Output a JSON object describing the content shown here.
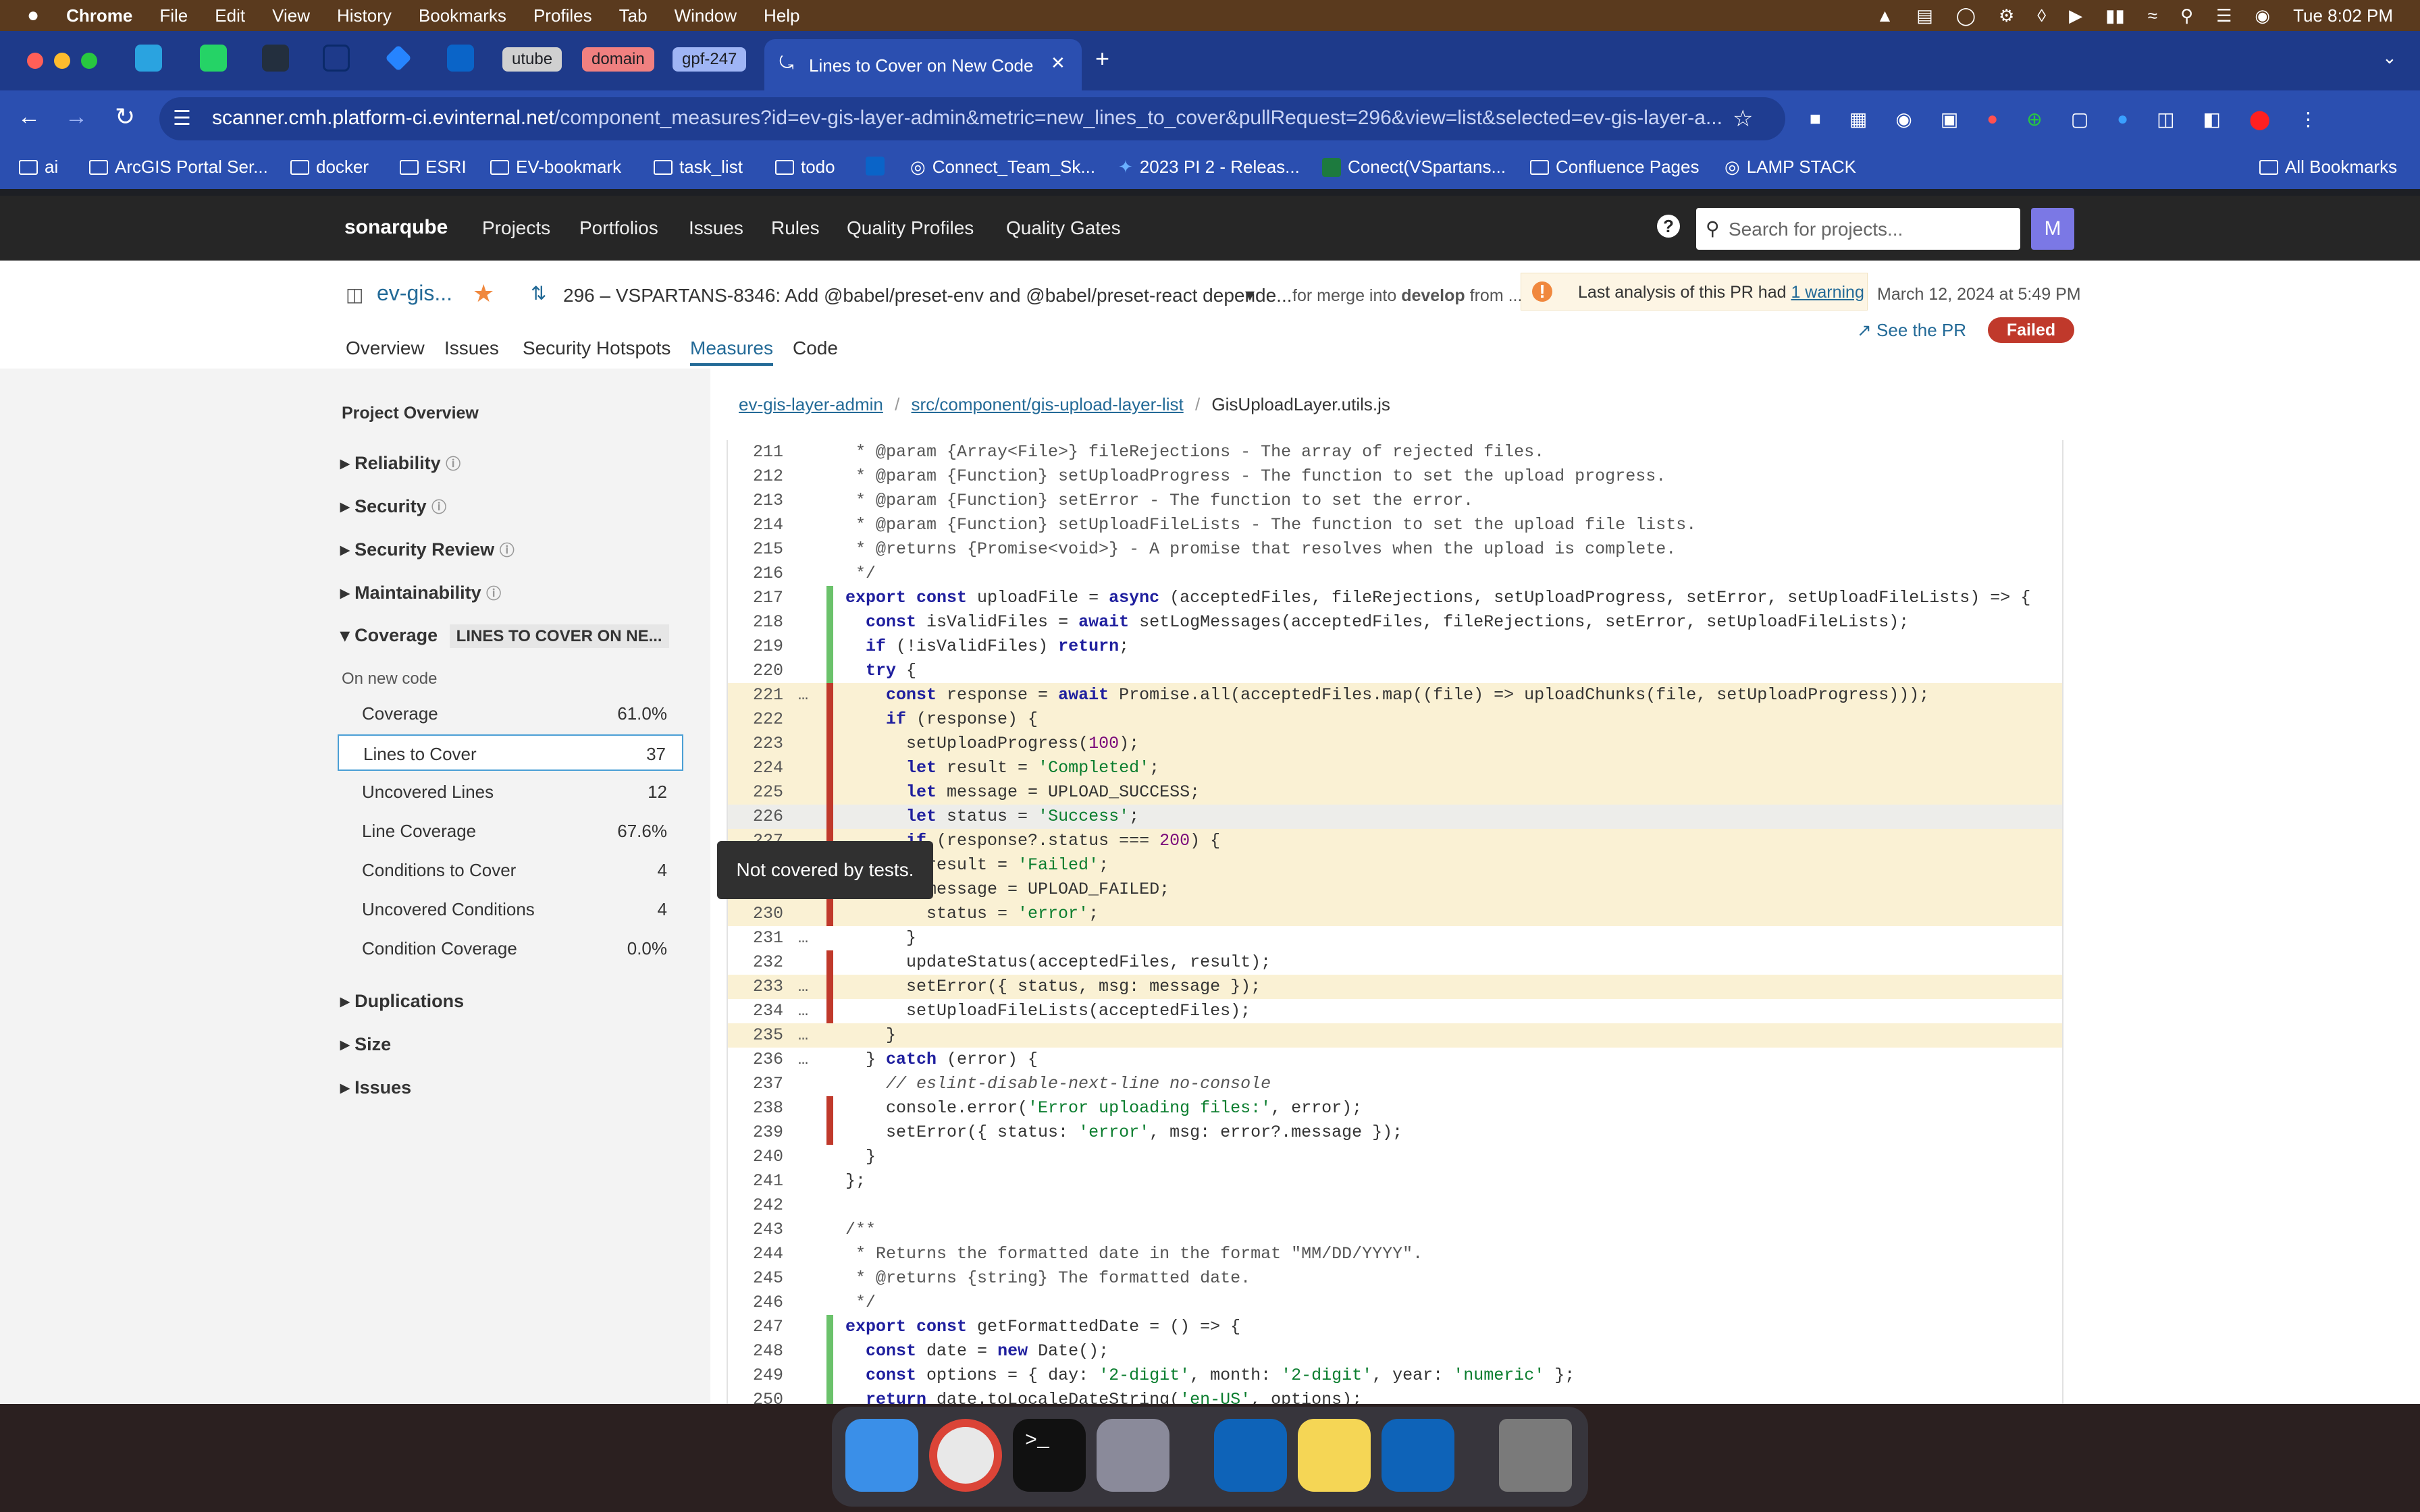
{
  "menubar": {
    "apple": "",
    "items": [
      "Chrome",
      "File",
      "Edit",
      "View",
      "History",
      "Bookmarks",
      "Profiles",
      "Tab",
      "Window",
      "Help"
    ],
    "clock": "Tue 8:02 PM"
  },
  "chrome": {
    "tab_groups": [
      "utube",
      "domain",
      "gpf-247"
    ],
    "active_tab_title": "Lines to Cover on New Code",
    "url_host": "scanner.cmh.platform-ci.evinternal.net",
    "url_path": "/component_measures?id=ev-gis-layer-admin&metric=new_lines_to_cover&pullRequest=296&view=list&selected=ev-gis-layer-a...",
    "bookmarks": [
      "ai",
      "ArcGIS Portal Ser...",
      "docker",
      "ESRI",
      "EV-bookmark",
      "task_list",
      "todo",
      "Connect_Team_Sk...",
      "2023 PI 2 - Releas...",
      "Conect(VSpartans...",
      "Confluence Pages",
      "LAMP STACK"
    ],
    "all_bookmarks": "All Bookmarks"
  },
  "sonar": {
    "logo": "sonarqube",
    "nav": [
      "Projects",
      "Portfolios",
      "Issues",
      "Rules",
      "Quality Profiles",
      "Quality Gates"
    ],
    "search_placeholder": "Search for projects...",
    "avatar": "M",
    "project_name": "ev-gis...",
    "pr_title": "296 – VSPARTANS-8346: Add @babel/preset-env and @babel/preset-react depende...",
    "merge_info_prefix": "for merge into",
    "merge_target": "develop",
    "merge_info_suffix": "from ...",
    "warning_text": "Last analysis of this PR had",
    "warning_link": "1 warning",
    "analysis_date": "March 12, 2024 at 5:49 PM",
    "see_pr": "See the PR",
    "status": "Failed",
    "tabs": [
      "Overview",
      "Issues",
      "Security Hotspots",
      "Measures",
      "Code"
    ],
    "active_tab": "Measures",
    "colors": {
      "failed": "#c0392b",
      "accent": "#236a97",
      "covered": "#6bc26b",
      "uncovered": "#c0392b",
      "uncovered_bg": "#faf1d4"
    }
  },
  "sidebar": {
    "heading": "Project Overview",
    "sections_top": [
      "Reliability",
      "Security",
      "Security Review",
      "Maintainability"
    ],
    "coverage_label": "Coverage",
    "coverage_badge": "LINES TO COVER ON NE...",
    "on_new_code": "On new code",
    "metrics": [
      {
        "label": "Coverage",
        "value": "61.0%"
      },
      {
        "label": "Lines to Cover",
        "value": "37"
      },
      {
        "label": "Uncovered Lines",
        "value": "12"
      },
      {
        "label": "Line Coverage",
        "value": "67.6%"
      },
      {
        "label": "Conditions to Cover",
        "value": "4"
      },
      {
        "label": "Uncovered Conditions",
        "value": "4"
      },
      {
        "label": "Condition Coverage",
        "value": "0.0%"
      }
    ],
    "sections_bottom": [
      "Duplications",
      "Size",
      "Issues"
    ]
  },
  "breadcrumb": {
    "project": "ev-gis-layer-admin",
    "path": "src/component/gis-upload-layer-list",
    "file": "GisUploadLayer.utils.js"
  },
  "tooltip": "Not covered by tests.",
  "code": [
    {
      "n": "211",
      "t": " * @param {Array<File>} fileRejections - The array of rejected files.",
      "c": "none",
      "hl": false,
      "d": false
    },
    {
      "n": "212",
      "t": " * @param {Function} setUploadProgress - The function to set the upload progress.",
      "c": "none",
      "hl": false,
      "d": false
    },
    {
      "n": "213",
      "t": " * @param {Function} setError - The function to set the error.",
      "c": "none",
      "hl": false,
      "d": false
    },
    {
      "n": "214",
      "t": " * @param {Function} setUploadFileLists - The function to set the upload file lists.",
      "c": "none",
      "hl": false,
      "d": false
    },
    {
      "n": "215",
      "t": " * @returns {Promise<void>} - A promise that resolves when the upload is complete.",
      "c": "none",
      "hl": false,
      "d": false
    },
    {
      "n": "216",
      "t": " */",
      "c": "none",
      "hl": false,
      "d": false
    },
    {
      "n": "217",
      "t": "export const uploadFile = async (acceptedFiles, fileRejections, setUploadProgress, setError, setUploadFileLists) => {",
      "c": "covered",
      "hl": false,
      "d": false
    },
    {
      "n": "218",
      "t": "  const isValidFiles = await setLogMessages(acceptedFiles, fileRejections, setError, setUploadFileLists);",
      "c": "covered",
      "hl": false,
      "d": false
    },
    {
      "n": "219",
      "t": "  if (!isValidFiles) return;",
      "c": "covered",
      "hl": false,
      "d": false
    },
    {
      "n": "220",
      "t": "  try {",
      "c": "covered",
      "hl": false,
      "d": false
    },
    {
      "n": "221",
      "t": "    const response = await Promise.all(acceptedFiles.map((file) => uploadChunks(file, setUploadProgress)));",
      "c": "uncovered",
      "hl": true,
      "d": true
    },
    {
      "n": "222",
      "t": "    if (response) {",
      "c": "uncovered",
      "hl": true,
      "d": false
    },
    {
      "n": "223",
      "t": "      setUploadProgress(100);",
      "c": "uncovered",
      "hl": true,
      "d": false
    },
    {
      "n": "224",
      "t": "      let result = 'Completed';",
      "c": "uncovered",
      "hl": true,
      "d": false
    },
    {
      "n": "225",
      "t": "      let message = UPLOAD_SUCCESS;",
      "c": "uncovered",
      "hl": true,
      "d": false
    },
    {
      "n": "226",
      "t": "      let status = 'Success';",
      "c": "uncovered",
      "hl": true,
      "d": false
    },
    {
      "n": "227",
      "t": "      if (response?.status === 200) {",
      "c": "uncovered",
      "hl": true,
      "d": false
    },
    {
      "n": "228",
      "t": "        result = 'Failed';",
      "c": "uncovered",
      "hl": true,
      "d": false
    },
    {
      "n": "229",
      "t": "        message = UPLOAD_FAILED;",
      "c": "uncovered",
      "hl": true,
      "d": false
    },
    {
      "n": "230",
      "t": "        status = 'error';",
      "c": "uncovered",
      "hl": true,
      "d": false
    },
    {
      "n": "231",
      "t": "      }",
      "c": "none",
      "hl": false,
      "d": true
    },
    {
      "n": "232",
      "t": "      updateStatus(acceptedFiles, result);",
      "c": "uncovered",
      "hl": false,
      "d": false
    },
    {
      "n": "233",
      "t": "      setError({ status, msg: message });",
      "c": "uncovered",
      "hl": true,
      "d": true
    },
    {
      "n": "234",
      "t": "      setUploadFileLists(acceptedFiles);",
      "c": "uncovered",
      "hl": false,
      "d": true
    },
    {
      "n": "235",
      "t": "    }",
      "c": "none",
      "hl": true,
      "d": true
    },
    {
      "n": "236",
      "t": "  } catch (error) {",
      "c": "none",
      "hl": false,
      "d": true
    },
    {
      "n": "237",
      "t": "    // eslint-disable-next-line no-console",
      "c": "none",
      "hl": false,
      "d": false
    },
    {
      "n": "238",
      "t": "    console.error('Error uploading files:', error);",
      "c": "uncovered",
      "hl": false,
      "d": false
    },
    {
      "n": "239",
      "t": "    setError({ status: 'error', msg: error?.message });",
      "c": "uncovered",
      "hl": false,
      "d": false
    },
    {
      "n": "240",
      "t": "  }",
      "c": "none",
      "hl": false,
      "d": false
    },
    {
      "n": "241",
      "t": "};",
      "c": "none",
      "hl": false,
      "d": false
    },
    {
      "n": "242",
      "t": "",
      "c": "none",
      "hl": false,
      "d": false
    },
    {
      "n": "243",
      "t": "/**",
      "c": "none",
      "hl": false,
      "d": false
    },
    {
      "n": "244",
      "t": " * Returns the formatted date in the format \"MM/DD/YYYY\".",
      "c": "none",
      "hl": false,
      "d": false
    },
    {
      "n": "245",
      "t": " * @returns {string} The formatted date.",
      "c": "none",
      "hl": false,
      "d": false
    },
    {
      "n": "246",
      "t": " */",
      "c": "none",
      "hl": false,
      "d": false
    },
    {
      "n": "247",
      "t": "export const getFormattedDate = () => {",
      "c": "covered",
      "hl": false,
      "d": false
    },
    {
      "n": "248",
      "t": "  const date = new Date();",
      "c": "covered",
      "hl": false,
      "d": false
    },
    {
      "n": "249",
      "t": "  const options = { day: '2-digit', month: '2-digit', year: 'numeric' };",
      "c": "covered",
      "hl": false,
      "d": false
    },
    {
      "n": "250",
      "t": "  return date.toLocaleDateString('en-US', options);",
      "c": "covered",
      "hl": false,
      "d": false
    }
  ]
}
